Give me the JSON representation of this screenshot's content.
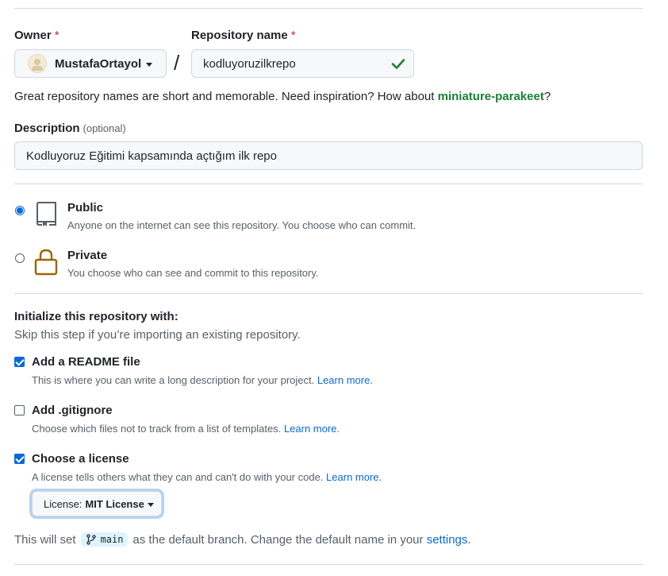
{
  "owner": {
    "label": "Owner",
    "required_mark": "*",
    "name": "MustafaOrtayol"
  },
  "repository": {
    "label": "Repository name",
    "required_mark": "*",
    "value": "kodluyoruzilkrepo",
    "separator": "/"
  },
  "hint": {
    "text": "Great repository names are short and memorable. Need inspiration? How about ",
    "suggestion": "miniature-parakeet",
    "suffix": "?"
  },
  "description": {
    "label": "Description",
    "optional": "(optional)",
    "value": "Kodluyoruz Eğitimi kapsamında açtığım ilk repo"
  },
  "visibility": {
    "public": {
      "title": "Public",
      "subtitle": "Anyone on the internet can see this repository. You choose who can commit.",
      "selected": true
    },
    "private": {
      "title": "Private",
      "subtitle": "You choose who can see and commit to this repository.",
      "selected": false
    }
  },
  "init": {
    "title": "Initialize this repository with:",
    "subtitle": "Skip this step if you’re importing an existing repository.",
    "readme": {
      "label": "Add a README file",
      "desc": "This is where you can write a long description for your project.",
      "link": "Learn more.",
      "checked": true
    },
    "gitignore": {
      "label": "Add .gitignore",
      "desc": "Choose which files not to track from a list of templates.",
      "link": "Learn more.",
      "checked": false
    },
    "license": {
      "label": "Choose a license",
      "desc": "A license tells others what they can and can't do with your code.",
      "link": "Learn more.",
      "checked": true,
      "select_prefix": "License:",
      "select_value": "MIT License"
    }
  },
  "footer": {
    "before": "This will set",
    "branch": "main",
    "after": "as the default branch. Change the default name in your",
    "link": "settings",
    "end": "."
  },
  "colors": {
    "accent": "#0969da",
    "success": "#1a7f37",
    "danger": "#cf222e",
    "muted": "#57606a"
  },
  "icons": {
    "check": "check-icon",
    "repo": "repo-icon",
    "lock": "lock-icon",
    "branch": "git-branch-icon",
    "caret": "caret-down-icon"
  }
}
